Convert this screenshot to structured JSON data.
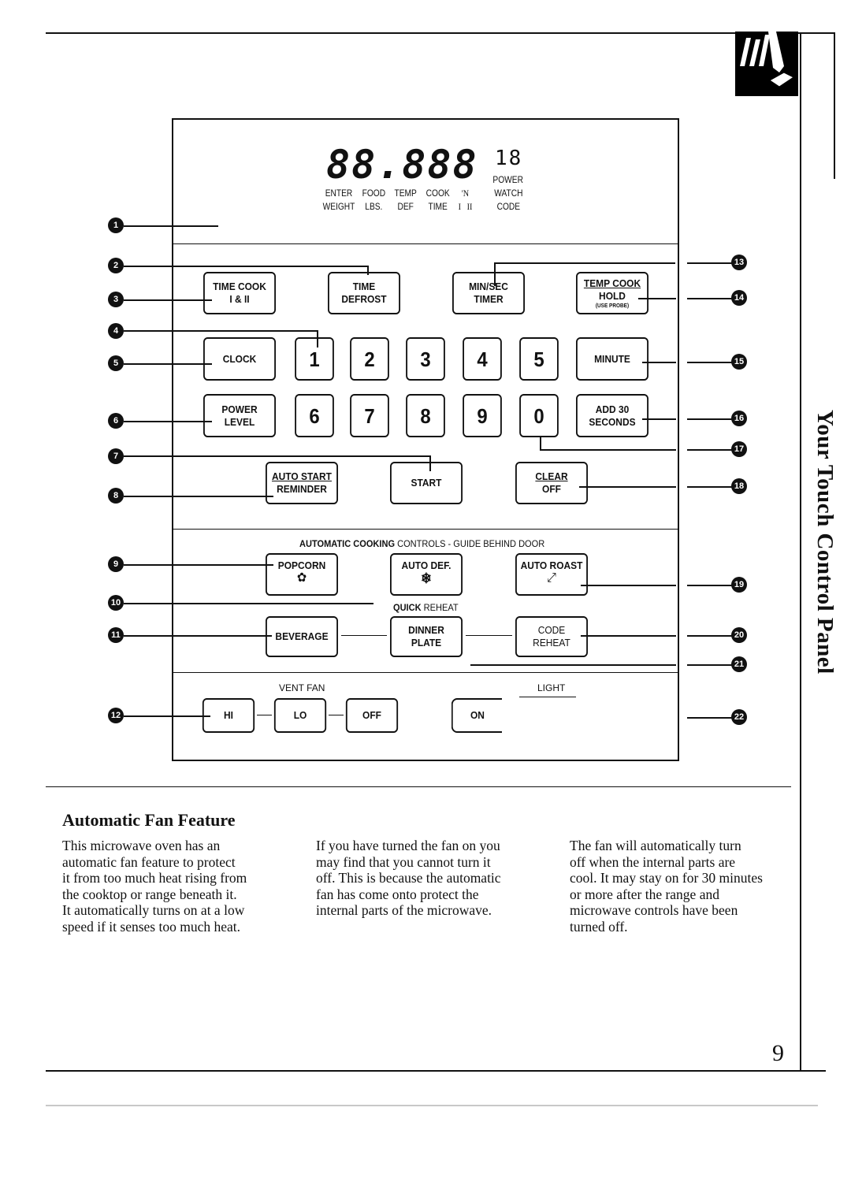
{
  "side_title": "Your Touch Control Panel",
  "page_number": "9",
  "display": {
    "segments": "88.888",
    "small_digits": "18",
    "labels": [
      {
        "top": "ENTER",
        "bottom": "WEIGHT"
      },
      {
        "top": "FOOD",
        "bottom": "LBS."
      },
      {
        "top": "TEMP",
        "bottom": "DEF"
      },
      {
        "top": "COOK",
        "bottom": "TIME"
      },
      {
        "top": "'N",
        "bottom": "I   II"
      },
      {
        "top": "WATCH",
        "bottom": "CODE",
        "above": "POWER"
      }
    ]
  },
  "buttons": {
    "time_cook": {
      "line1": "TIME COOK",
      "line2": "I & II"
    },
    "time_defrost": {
      "line1": "TIME",
      "line2": "DEFROST"
    },
    "min_sec_timer": {
      "line1": "MIN/SEC",
      "line2": "TIMER"
    },
    "temp_cook_hold": {
      "line1": "TEMP COOK",
      "line2": "HOLD",
      "line3": "(USE PROBE)"
    },
    "clock": "CLOCK",
    "digits": [
      "1",
      "2",
      "3",
      "4",
      "5",
      "6",
      "7",
      "8",
      "9",
      "0"
    ],
    "minute": "MINUTE",
    "power_level": {
      "line1": "POWER",
      "line2": "LEVEL"
    },
    "add_30": {
      "line1": "ADD 30",
      "line2": "SECONDS"
    },
    "auto_start": {
      "line1": "AUTO START",
      "line2": "REMINDER"
    },
    "start": "START",
    "clear_off": {
      "line1": "CLEAR",
      "line2": "OFF"
    },
    "popcorn": "POPCORN",
    "auto_def": "AUTO DEF.",
    "auto_roast": "AUTO ROAST",
    "beverage": "BEVERAGE",
    "dinner_plate": {
      "line1": "DINNER",
      "line2": "PLATE"
    },
    "code_reheat": {
      "line1": "CODE",
      "line2": "REHEAT"
    },
    "hi": "HI",
    "lo": "LO",
    "off": "OFF",
    "on": "ON"
  },
  "section_labels": {
    "auto_cooking_bold": "AUTOMATIC COOKING",
    "auto_cooking_rest": " CONTROLS - GUIDE BEHIND DOOR",
    "quick_bold": "QUICK",
    "quick_rest": " REHEAT",
    "vent_fan": "VENT FAN",
    "light": "LIGHT"
  },
  "callouts": [
    "1",
    "2",
    "3",
    "4",
    "5",
    "6",
    "7",
    "8",
    "9",
    "10",
    "11",
    "12",
    "13",
    "14",
    "15",
    "16",
    "17",
    "18",
    "19",
    "20",
    "21",
    "22"
  ],
  "article": {
    "heading": "Automatic Fan Feature",
    "col1": "This microwave oven has an\nautomatic fan feature to protect\nit from too much heat rising from\nthe cooktop or range beneath it.\nIt automatically turns on at a low\nspeed if it senses too much heat.",
    "col2": "If you have turned the fan on you\nmay find that you cannot turn it\noff. This is because the automatic\nfan has come onto protect the\ninternal parts of the microwave.",
    "col3": "The fan will automatically turn\noff when the internal parts are\ncool. It may stay on for 30 minutes\nor more after the range and\nmicrowave controls have been\nturned off."
  }
}
